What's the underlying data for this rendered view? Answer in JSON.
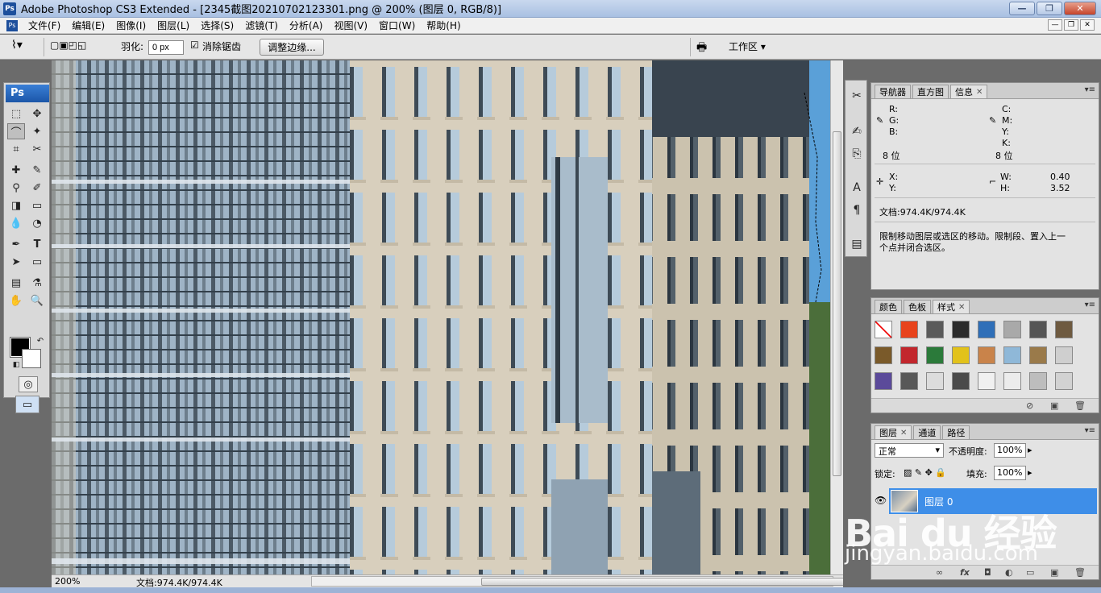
{
  "window": {
    "title": "Adobe Photoshop CS3 Extended - [2345截图20210702123301.png @ 200% (图层 0, RGB/8)]",
    "app_icon": "Ps"
  },
  "menu": [
    "文件(F)",
    "编辑(E)",
    "图像(I)",
    "图层(L)",
    "选择(S)",
    "滤镜(T)",
    "分析(A)",
    "视图(V)",
    "窗口(W)",
    "帮助(H)"
  ],
  "options": {
    "feather_label": "羽化:",
    "feather_value": "0 px",
    "antialias_label": "消除锯齿",
    "antialias_checked": true,
    "refine_edge_label": "调整边缘...",
    "workspace_label": "工作区 ▾"
  },
  "toolbox": {
    "badge": "Ps"
  },
  "status": {
    "zoom": "200%",
    "doc_info": "文档:974.4K/974.4K"
  },
  "info_panel": {
    "tabs": [
      "导航器",
      "直方图",
      "信息"
    ],
    "r": "R:",
    "g": "G:",
    "b": "B:",
    "c": "C:",
    "m": "M:",
    "y": "Y:",
    "k": "K:",
    "bits_left": "8 位",
    "bits_right": "8 位",
    "x": "X:",
    "y2": "Y:",
    "w_label": "W:",
    "w_value": "0.40",
    "h_label": "H:",
    "h_value": "3.52",
    "doc": "文档:974.4K/974.4K",
    "hint_line1": "限制移动图层或选区的移动。限制段、置入上一",
    "hint_line2": "个点并闭合选区。"
  },
  "styles_panel": {
    "tabs": [
      "颜色",
      "色板",
      "样式"
    ],
    "swatches": [
      "#ffffff",
      "#e8431c",
      "#5a5a5a",
      "#2b2b2b",
      "#2f6fb8",
      "#a9a9a9",
      "#555555",
      "#6e5a40",
      "#7a5a2a",
      "#c2272d",
      "#2b7a3a",
      "#e2c21b",
      "#c9834a",
      "#8fb8d8",
      "#9a7a4a",
      "#cfcfcf",
      "#5b4a9a",
      "#585858",
      "#dcdcdc",
      "#4a4a4a",
      "#f0f0f0",
      "#ececec",
      "#bdbdbd",
      "#d2d2d2"
    ]
  },
  "layers_panel": {
    "tabs": [
      "图层",
      "通道",
      "路径"
    ],
    "blend_mode": "正常",
    "opacity_label": "不透明度:",
    "opacity_value": "100%",
    "lock_label": "锁定:",
    "fill_label": "填充:",
    "fill_value": "100%",
    "layer_name": "图层 0"
  },
  "watermark": {
    "brand": "Bai du 经验",
    "url": "jingyan.baidu.com"
  }
}
